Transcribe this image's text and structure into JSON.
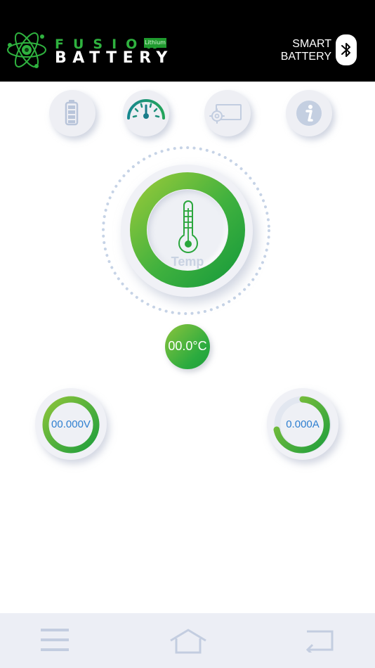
{
  "header": {
    "brand_line1": "FUSION",
    "brand_tag": "Lithium",
    "brand_line2": "BATTERY",
    "smart_line1": "SMART",
    "smart_line2": "BATTERY"
  },
  "tabs": [
    {
      "name": "battery",
      "icon": "battery-icon"
    },
    {
      "name": "gauge",
      "icon": "speedometer-icon",
      "active": true
    },
    {
      "name": "settings",
      "icon": "settings-screen-icon"
    },
    {
      "name": "info",
      "icon": "info-icon"
    }
  ],
  "dial": {
    "label": "Temp",
    "icon": "thermometer-icon"
  },
  "temperature": {
    "value": "00.0°C"
  },
  "voltage": {
    "value": "00.000V"
  },
  "current": {
    "value": "0.000A"
  },
  "bottom_nav": [
    {
      "name": "menu",
      "icon": "hamburger-menu-icon"
    },
    {
      "name": "home",
      "icon": "home-icon"
    },
    {
      "name": "back",
      "icon": "back-arrow-icon"
    }
  ],
  "colors": {
    "header_bg": "#000000",
    "brand_green": "#2fb23f",
    "accent_green": "#2bab3f",
    "value_blue": "#2e7fd0",
    "icon_grey": "#b9c5da"
  }
}
